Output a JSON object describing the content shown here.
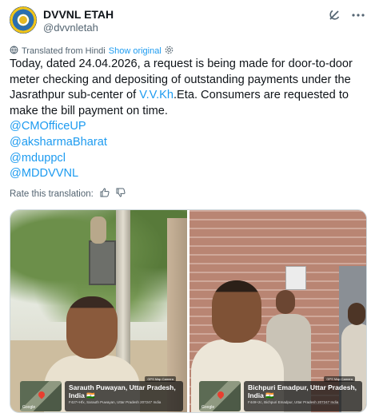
{
  "author": {
    "display_name": "DVVNL ETAH",
    "handle": "@dvvnletah"
  },
  "translation": {
    "label": "Translated from Hindi",
    "show_original": "Show original"
  },
  "tweet": {
    "text_before_link": "Today, dated 24.04.2026, a request is being made for door-to-door meter checking and depositing of outstanding payments under the Jasrathpur sub-center of ",
    "link_text": "V.V.Kh",
    "text_after_link": ".Eta. Consumers are requested to make the bill payment on time.",
    "mentions": [
      "@CMOfficeUP",
      "@aksharmaBharat",
      "@mduppcl",
      "@MDDVVNL"
    ]
  },
  "rate": {
    "label": "Rate this translation:"
  },
  "media": [
    {
      "gps_app": "GPS Map Camera",
      "place": "Sarauth Puwayan, Uttar Pradesh, India 🇮🇳",
      "address": "F427+Hfx, Sarauth Puwayan, Uttar Pradesh 207247 India",
      "map_label": "Google"
    },
    {
      "gps_app": "GPS Map Camera",
      "place": "Bichpuri Emadpur, Uttar Pradesh, India 🇮🇳",
      "address": "F449+2c, Bichpuri Emadpur, Uttar Pradesh 207247 India",
      "map_label": "Google"
    }
  ],
  "colors": {
    "link": "#1d9bf0",
    "secondary_text": "#536471",
    "primary_text": "#0f1419"
  }
}
